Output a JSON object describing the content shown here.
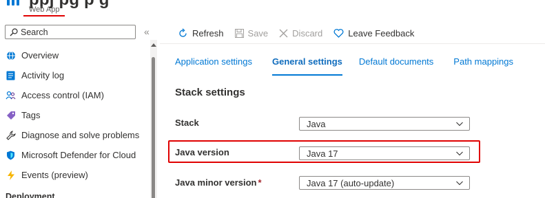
{
  "header": {
    "title_fragment": "ppj      pg  p  g",
    "subtitle": "Web App"
  },
  "sidebar": {
    "search": {
      "placeholder": "Search"
    },
    "collapse_icon": "«",
    "items": [
      {
        "label": "Overview",
        "icon": "globe-icon"
      },
      {
        "label": "Activity log",
        "icon": "activity-log-icon"
      },
      {
        "label": "Access control (IAM)",
        "icon": "people-icon"
      },
      {
        "label": "Tags",
        "icon": "tag-icon"
      },
      {
        "label": "Diagnose and solve problems",
        "icon": "wrench-icon"
      },
      {
        "label": "Microsoft Defender for Cloud",
        "icon": "shield-icon"
      },
      {
        "label": "Events (preview)",
        "icon": "lightning-icon"
      }
    ],
    "section_label": "Deployment"
  },
  "toolbar": {
    "refresh_label": "Refresh",
    "save_label": "Save",
    "discard_label": "Discard",
    "feedback_label": "Leave Feedback"
  },
  "tabs": [
    {
      "label": "Application settings",
      "active": false
    },
    {
      "label": "General settings",
      "active": true
    },
    {
      "label": "Default documents",
      "active": false
    },
    {
      "label": "Path mappings",
      "active": false
    }
  ],
  "stack_settings": {
    "heading": "Stack settings",
    "rows": [
      {
        "label": "Stack",
        "value": "Java",
        "required": false
      },
      {
        "label": "Java version",
        "value": "Java 17",
        "required": false,
        "highlighted": true
      },
      {
        "label": "Java minor version",
        "value": "Java 17 (auto-update)",
        "required": true
      }
    ]
  },
  "colors": {
    "accent": "#0078d4",
    "highlight": "#e00000",
    "text": "#323130",
    "disabled": "#a19f9d"
  }
}
